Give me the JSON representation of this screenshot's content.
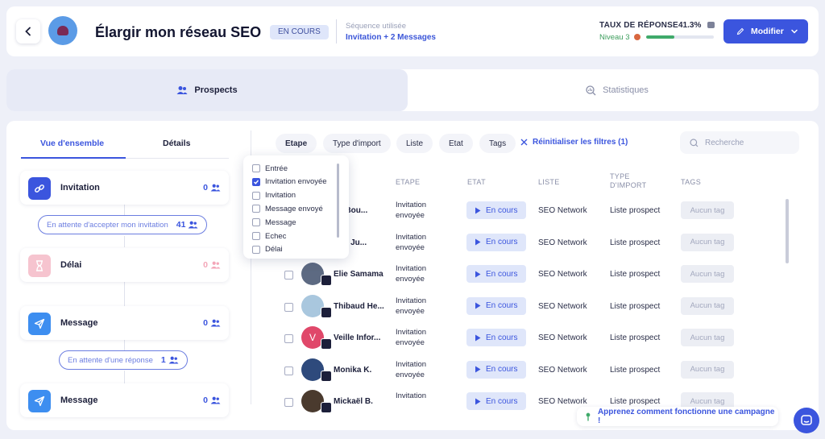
{
  "header": {
    "title": "Élargir mon réseau SEO",
    "status": "EN COURS",
    "sequence_label": "Séquence utilisée",
    "sequence_value": "Invitation + 2 Messages",
    "response_rate_label": "TAUX DE RÉPONSE",
    "response_rate_value": "41.3%",
    "response_rate_fraction": 0.413,
    "level_label": "Niveau 3",
    "modify_label": "Modifier",
    "colors": {
      "accent": "#3b55de",
      "progress": "#3faa6a"
    }
  },
  "tabs": [
    {
      "label": "Prospects",
      "icon": "users-icon",
      "active": true
    },
    {
      "label": "Statistiques",
      "icon": "stats-icon",
      "active": false
    }
  ],
  "left_panel": {
    "tabs": [
      {
        "label": "Vue d'ensemble",
        "active": true
      },
      {
        "label": "Détails",
        "active": false
      }
    ],
    "steps": [
      {
        "label": "Invitation",
        "count": "0",
        "icon": "link-icon",
        "color": "#3b55de"
      },
      {
        "label": "Délai",
        "count": "0",
        "icon": "hourglass-icon",
        "color": "#f6c4cf"
      },
      {
        "label": "Message",
        "count": "0",
        "icon": "send-icon",
        "color": "#3d8ef0"
      },
      {
        "label": "Message",
        "count": "0",
        "icon": "send-icon",
        "color": "#3d8ef0"
      }
    ],
    "waiting": [
      {
        "label": "En attente d'accepter mon invitation",
        "count": "41"
      },
      {
        "label": "En attente d'une réponse",
        "count": "1"
      }
    ]
  },
  "filters": {
    "chips": [
      "Etape",
      "Type d'import",
      "Liste",
      "Etat",
      "Tags"
    ],
    "active": "Etape",
    "reset_label": "Réinitialiser les filtres (1)",
    "search_placeholder": "Recherche"
  },
  "dropdown": {
    "options": [
      {
        "label": "Entrée",
        "checked": false
      },
      {
        "label": "Invitation envoyée",
        "checked": true
      },
      {
        "label": "Invitation",
        "checked": false
      },
      {
        "label": "Message envoyé",
        "checked": false
      },
      {
        "label": "Message",
        "checked": false
      },
      {
        "label": "Echec",
        "checked": false
      },
      {
        "label": "Délai",
        "checked": false
      }
    ]
  },
  "table": {
    "columns": [
      "ETAPE",
      "ETAT",
      "LISTE",
      "TYPE D'IMPORT",
      "TAGS"
    ],
    "rows": [
      {
        "name": "an Bou...",
        "etape": "Invitation envoyée",
        "etat": "En cours",
        "liste": "SEO Network",
        "import": "Liste prospect",
        "tag": "Aucun tag",
        "avatar_color": "#8a7a6a",
        "initial": ""
      },
      {
        "name": "ntin Ju...",
        "etape": "Invitation envoyée",
        "etat": "En cours",
        "liste": "SEO Network",
        "import": "Liste prospect",
        "tag": "Aucun tag",
        "avatar_color": "#9b8b7c",
        "initial": ""
      },
      {
        "name": "Elie Samama",
        "etape": "Invitation envoyée",
        "etat": "En cours",
        "liste": "SEO Network",
        "import": "Liste prospect",
        "tag": "Aucun tag",
        "avatar_color": "#5d6a82",
        "initial": ""
      },
      {
        "name": "Thibaud He...",
        "etape": "Invitation envoyée",
        "etat": "En cours",
        "liste": "SEO Network",
        "import": "Liste prospect",
        "tag": "Aucun tag",
        "avatar_color": "#a9c7de",
        "initial": ""
      },
      {
        "name": "Veille Infor...",
        "etape": "Invitation envoyée",
        "etat": "En cours",
        "liste": "SEO Network",
        "import": "Liste prospect",
        "tag": "Aucun tag",
        "avatar_color": "#e0486a",
        "initial": "V"
      },
      {
        "name": "Monika K.",
        "etape": "Invitation envoyée",
        "etat": "En cours",
        "liste": "SEO Network",
        "import": "Liste prospect",
        "tag": "Aucun tag",
        "avatar_color": "#2e4a7c",
        "initial": ""
      },
      {
        "name": "Mickaël B.",
        "etape": "Invitation",
        "etat": "En cours",
        "liste": "SEO Network",
        "import": "Liste prospect",
        "tag": "Aucun tag",
        "avatar_color": "#4a3a2e",
        "initial": ""
      }
    ]
  },
  "footer": {
    "help_label": "Apprenez comment fonctionne une campagne !"
  }
}
